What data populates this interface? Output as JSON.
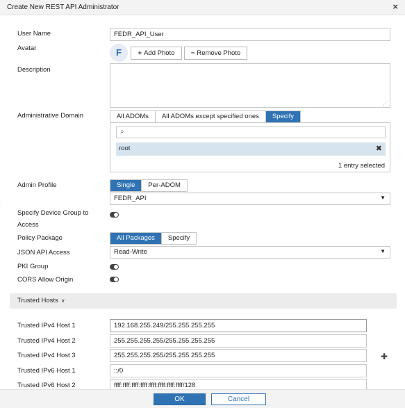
{
  "dialog": {
    "title": "Create New REST API Administrator",
    "close_icon": "×"
  },
  "user_name": {
    "label": "User Name",
    "value": "FEDR_API_User"
  },
  "avatar": {
    "label": "Avatar",
    "initial": "F",
    "add_label": "Add Photo",
    "add_icon": "+",
    "remove_label": "Remove Photo",
    "remove_icon": "−"
  },
  "description": {
    "label": "Description",
    "value": ""
  },
  "admin_domain": {
    "label": "Administrative Domain",
    "options": [
      "All ADOMs",
      "All ADOMs except specified ones",
      "Specify"
    ],
    "selected": "Specify",
    "search_placeholder": "",
    "items": [
      "root"
    ],
    "count_text": "1 entry selected"
  },
  "admin_profile": {
    "label": "Admin Profile",
    "options": [
      "Single",
      "Per-ADOM"
    ],
    "selected": "Single",
    "value": "FEDR_API"
  },
  "device_group": {
    "label_line1": "Specify Device Group to",
    "label_line2": "Access",
    "enabled": false
  },
  "policy_package": {
    "label": "Policy Package",
    "options": [
      "All Packages",
      "Specify"
    ],
    "selected": "All Packages"
  },
  "json_api": {
    "label": "JSON API Access",
    "value": "Read-Write"
  },
  "pki_group": {
    "label": "PKI Group",
    "enabled": false
  },
  "cors": {
    "label": "CORS Allow Origin",
    "enabled": false
  },
  "trusted_hosts": {
    "section_label": "Trusted Hosts",
    "hosts": [
      {
        "label": "Trusted IPv4 Host 1",
        "value": "192.168.255.249/255.255.255.255"
      },
      {
        "label": "Trusted IPv4 Host 2",
        "value": "255.255.255.255/255.255.255.255"
      },
      {
        "label": "Trusted IPv4 Host 3",
        "value": "255.255.255.255/255.255.255.255"
      },
      {
        "label": "Trusted IPv6 Host 1",
        "value": "::/0"
      },
      {
        "label": "Trusted IPv6 Host 2",
        "value": "ffff:ffff:ffff:ffff:ffff:ffff:ffff:ffff/128"
      }
    ]
  },
  "footer": {
    "ok_label": "OK",
    "cancel_label": "Cancel"
  },
  "colors": {
    "accent": "#2f73b4",
    "selected_row": "#d5e4ef",
    "section_bg": "#ececec"
  }
}
